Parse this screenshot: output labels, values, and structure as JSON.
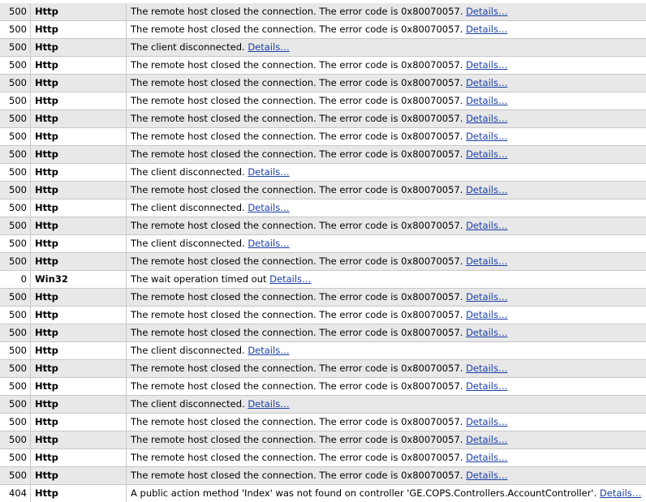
{
  "error_log": {
    "rows": [
      {
        "code": "500",
        "type": "Http",
        "message": "The remote host closed the connection. The error code is 0x80070057.",
        "details": "Details…"
      },
      {
        "code": "500",
        "type": "Http",
        "message": "The remote host closed the connection. The error code is 0x80070057.",
        "details": "Details…"
      },
      {
        "code": "500",
        "type": "Http",
        "message": "The client disconnected.",
        "details": "Details…"
      },
      {
        "code": "500",
        "type": "Http",
        "message": "The remote host closed the connection. The error code is 0x80070057.",
        "details": "Details…"
      },
      {
        "code": "500",
        "type": "Http",
        "message": "The remote host closed the connection. The error code is 0x80070057.",
        "details": "Details…"
      },
      {
        "code": "500",
        "type": "Http",
        "message": "The remote host closed the connection. The error code is 0x80070057.",
        "details": "Details…"
      },
      {
        "code": "500",
        "type": "Http",
        "message": "The remote host closed the connection. The error code is 0x80070057.",
        "details": "Details…"
      },
      {
        "code": "500",
        "type": "Http",
        "message": "The remote host closed the connection. The error code is 0x80070057.",
        "details": "Details…"
      },
      {
        "code": "500",
        "type": "Http",
        "message": "The remote host closed the connection. The error code is 0x80070057.",
        "details": "Details…"
      },
      {
        "code": "500",
        "type": "Http",
        "message": "The client disconnected.",
        "details": "Details…"
      },
      {
        "code": "500",
        "type": "Http",
        "message": "The remote host closed the connection. The error code is 0x80070057.",
        "details": "Details…"
      },
      {
        "code": "500",
        "type": "Http",
        "message": "The client disconnected.",
        "details": "Details…"
      },
      {
        "code": "500",
        "type": "Http",
        "message": "The remote host closed the connection. The error code is 0x80070057.",
        "details": "Details…"
      },
      {
        "code": "500",
        "type": "Http",
        "message": "The client disconnected.",
        "details": "Details…"
      },
      {
        "code": "500",
        "type": "Http",
        "message": "The remote host closed the connection. The error code is 0x80070057.",
        "details": "Details…"
      },
      {
        "code": "0",
        "type": "Win32",
        "message": "The wait operation timed out",
        "details": "Details…"
      },
      {
        "code": "500",
        "type": "Http",
        "message": "The remote host closed the connection. The error code is 0x80070057.",
        "details": "Details…"
      },
      {
        "code": "500",
        "type": "Http",
        "message": "The remote host closed the connection. The error code is 0x80070057.",
        "details": "Details…"
      },
      {
        "code": "500",
        "type": "Http",
        "message": "The remote host closed the connection. The error code is 0x80070057.",
        "details": "Details…"
      },
      {
        "code": "500",
        "type": "Http",
        "message": "The client disconnected.",
        "details": "Details…"
      },
      {
        "code": "500",
        "type": "Http",
        "message": "The remote host closed the connection. The error code is 0x80070057.",
        "details": "Details…"
      },
      {
        "code": "500",
        "type": "Http",
        "message": "The remote host closed the connection. The error code is 0x80070057.",
        "details": "Details…"
      },
      {
        "code": "500",
        "type": "Http",
        "message": "The client disconnected.",
        "details": "Details…"
      },
      {
        "code": "500",
        "type": "Http",
        "message": "The remote host closed the connection. The error code is 0x80070057.",
        "details": "Details…"
      },
      {
        "code": "500",
        "type": "Http",
        "message": "The remote host closed the connection. The error code is 0x80070057.",
        "details": "Details…"
      },
      {
        "code": "500",
        "type": "Http",
        "message": "The remote host closed the connection. The error code is 0x80070057.",
        "details": "Details…"
      },
      {
        "code": "500",
        "type": "Http",
        "message": "The remote host closed the connection. The error code is 0x80070057.",
        "details": "Details…"
      },
      {
        "code": "404",
        "type": "Http",
        "message": "A public action method 'Index' was not found on controller 'GE.COPS.Controllers.AccountController'.",
        "details": "Details…"
      }
    ]
  }
}
